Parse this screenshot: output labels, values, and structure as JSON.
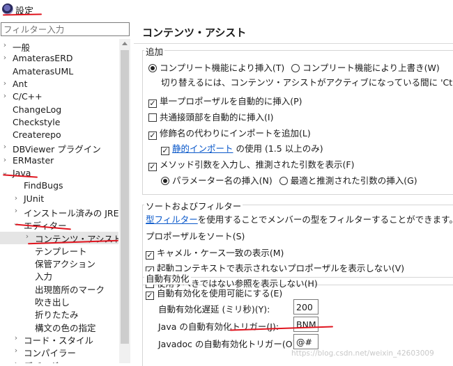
{
  "window": {
    "title": "設定"
  },
  "filter": {
    "placeholder": "フィルター入力"
  },
  "tree": [
    {
      "label": "一般",
      "chev": "›",
      "indent": 0
    },
    {
      "label": "AmaterasERD",
      "chev": "›",
      "indent": 0
    },
    {
      "label": "AmaterasUML",
      "chev": "",
      "indent": 0
    },
    {
      "label": "Ant",
      "chev": "›",
      "indent": 0
    },
    {
      "label": "C/C++",
      "chev": "›",
      "indent": 0
    },
    {
      "label": "ChangeLog",
      "chev": "",
      "indent": 0
    },
    {
      "label": "Checkstyle",
      "chev": "",
      "indent": 0
    },
    {
      "label": "Createrepo",
      "chev": "",
      "indent": 0
    },
    {
      "label": "DBViewer プラグイン",
      "chev": "›",
      "indent": 0
    },
    {
      "label": "ERMaster",
      "chev": "›",
      "indent": 0
    },
    {
      "label": "Java",
      "chev": "⌄",
      "indent": 0
    },
    {
      "label": "FindBugs",
      "chev": "",
      "indent": 1
    },
    {
      "label": "JUnit",
      "chev": "›",
      "indent": 1
    },
    {
      "label": "インストール済みの JRE",
      "chev": "›",
      "indent": 1
    },
    {
      "label": "エディター",
      "chev": "⌄",
      "indent": 1
    },
    {
      "label": "コンテンツ・アシスト",
      "chev": "›",
      "indent": 2,
      "selected": true
    },
    {
      "label": "テンプレート",
      "chev": "",
      "indent": 2
    },
    {
      "label": "保管アクション",
      "chev": "",
      "indent": 2
    },
    {
      "label": "入力",
      "chev": "",
      "indent": 2
    },
    {
      "label": "出現箇所のマーク",
      "chev": "",
      "indent": 2
    },
    {
      "label": "吹き出し",
      "chev": "",
      "indent": 2
    },
    {
      "label": "折りたたみ",
      "chev": "",
      "indent": 2
    },
    {
      "label": "構文の色の指定",
      "chev": "",
      "indent": 2
    },
    {
      "label": "コード・スタイル",
      "chev": "›",
      "indent": 1
    },
    {
      "label": "コンパイラー",
      "chev": "›",
      "indent": 1
    },
    {
      "label": "デバッグ",
      "chev": "›",
      "indent": 1
    }
  ],
  "page": {
    "title": "コンテンツ・アシスト",
    "insertion": {
      "legend": "追加",
      "radio_insert": "コンプリート機能により挿入(T)",
      "radio_overwrite": "コンプリート機能により上書き(W)",
      "hint": "切り替えるには、コンテンツ・アシストがアクティブになっている間に 'Ctrl' を",
      "opt_single": "単一プロポーザルを自動的に挿入(P)",
      "opt_common": "共通接頭部を自動的に挿入(I)",
      "opt_import": "修飾名の代わりにインポートを追加(L)",
      "static_link": "静的インポート",
      "static_suffix": " の使用 (1.5 以上のみ)",
      "opt_guess": "メソッド引数を入力し、推測された引数を表示(F)",
      "radio_param": "パラメーター名の挿入(N)",
      "radio_best": "最適と推測された引数の挿入(G)"
    },
    "sorting": {
      "legend": "ソートおよびフィルター",
      "type_filter_link": "型フィルター",
      "type_filter_text": "を使用することでメンバーの型をフィルターすることができます。",
      "sort_label": "プロポーザルをソート(S)",
      "opt_camel": "キャメル・ケース一致の表示(M)",
      "opt_context": "起動コンテキストで表示されないプロポーザルを表示しない(V)",
      "opt_deprecated": "使用すべきではない参照を表示しない(H)"
    },
    "auto": {
      "legend": "自動有効化",
      "opt_enable": "自動有効化を使用可能にする(E)",
      "delay_label": "自動有効化遅延 (ミリ秒)(Y):",
      "delay_value": "200",
      "java_label": "Java の自動有効化トリガー(J):",
      "java_value": "BNM",
      "javadoc_label": "Javadoc の自動有効化トリガー(O):",
      "javadoc_value": "@#"
    },
    "watermark": "https://blog.csdn.net/weixin_42603009"
  },
  "colors": {
    "annotation": "#e0151f",
    "link": "#0a58ca",
    "selection": "#e5e5e5"
  }
}
